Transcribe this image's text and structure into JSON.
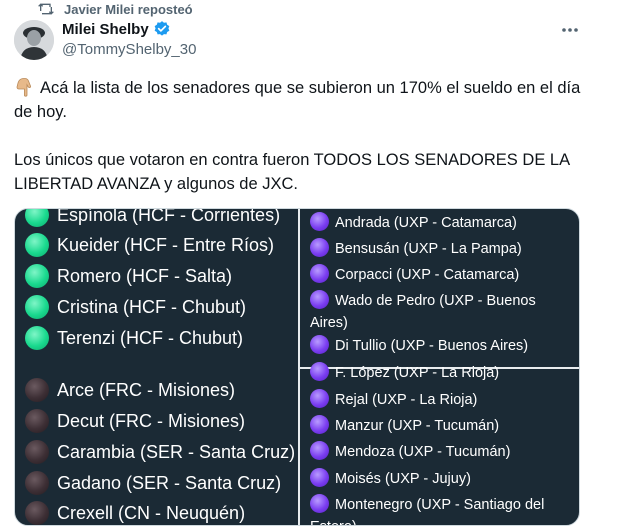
{
  "repost": {
    "text": "Javier Milei reposteó",
    "icon": "repost-icon"
  },
  "author": {
    "display_name": "Milei Shelby",
    "handle": "@TommyShelby_30",
    "verified_color": "#1d9bf0"
  },
  "tweet": {
    "line1": "Acá la lista de los senadores que se subieron un 170% el sueldo en el día de hoy.",
    "line2": "Los únicos que votaron en contra fueron TODOS LOS SENADORES DE LA LIBERTAD AVANZA y algunos de JXC."
  },
  "image": {
    "left_green": [
      "Espínola (HCF - Corrientes)",
      "Kueider (HCF - Entre Ríos)",
      "Romero (HCF - Salta)",
      "Cristina (HCF - Chubut)",
      "Terenzi (HCF - Chubut)"
    ],
    "left_dark": [
      "Arce (FRC - Misiones)",
      "Decut (FRC - Misiones)",
      "Carambia (SER - Santa Cruz)",
      "Gadano (SER - Santa Cruz)",
      "Crexell (CN - Neuquén)"
    ],
    "right_top": [
      "Andrada (UXP - Catamarca)",
      "Bensusán (UXP - La Pampa)",
      "Corpacci (UXP - Catamarca)",
      "Wado de Pedro (UXP - Buenos Aires)",
      "Di Tullio (UXP - Buenos Aires)"
    ],
    "right_bottom": [
      "F. López (UXP - La Rioja)",
      "Rejal (UXP - La Rioja)",
      "Manzur (UXP - Tucumán)",
      "Mendoza (UXP - Tucumán)",
      "Moisés (UXP - Jujuy)",
      "Montenegro (UXP - Santiago del Estero)"
    ],
    "colors": {
      "green_dot": "#19d98e",
      "dark_dot": "#3d2f35",
      "purple_dot": "#7a3df0",
      "background": "#1b2a35"
    }
  }
}
